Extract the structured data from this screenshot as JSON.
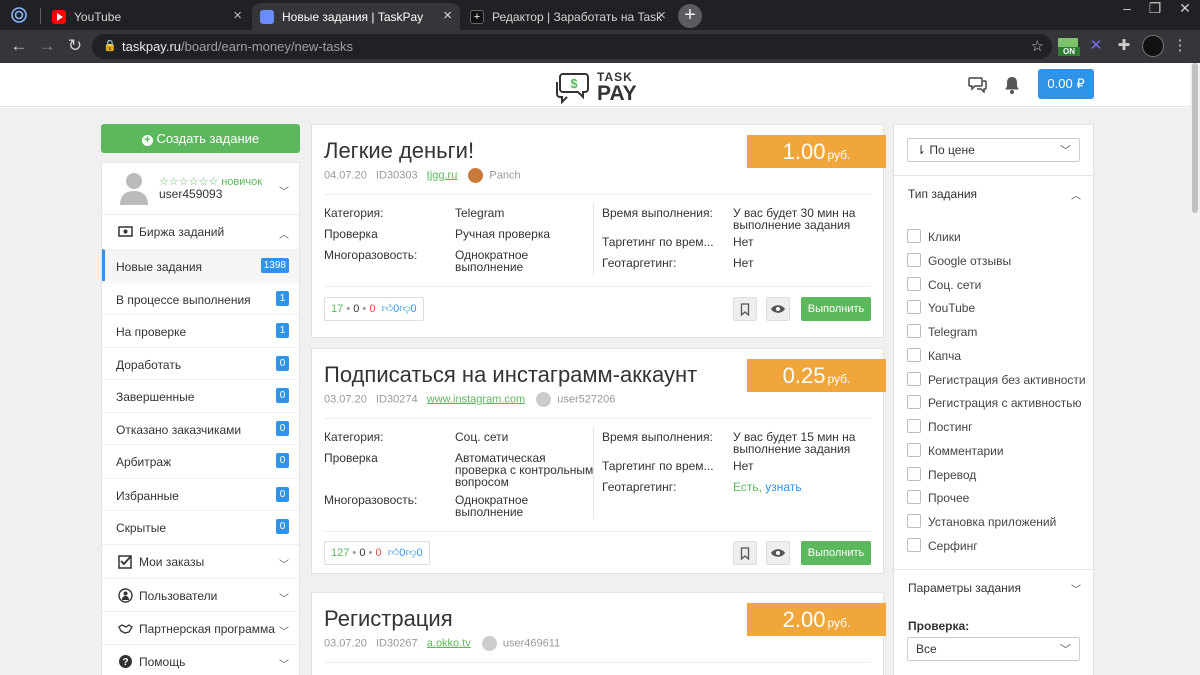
{
  "browser": {
    "tabs": [
      {
        "title": "YouTube"
      },
      {
        "title": "Новые задания | TaskPay"
      },
      {
        "title": "Редактор | Заработать на TaskPay"
      }
    ],
    "url_host": "taskpay.ru",
    "url_path": "/board/earn-money/new-tasks",
    "ext_badge": "ON"
  },
  "header": {
    "logo_top": "TASK",
    "logo_bottom": "PAY",
    "balance": "0.00 ₽"
  },
  "sidebar": {
    "create_button": "Создать задание",
    "user": {
      "rank": "☆☆☆☆☆☆ новичок",
      "name": "user459093"
    },
    "exchange_section": "Биржа заданий",
    "items": [
      {
        "label": "Новые задания",
        "count": "1398"
      },
      {
        "label": "В процессе выполнения",
        "count": "1"
      },
      {
        "label": "На проверке",
        "count": "1"
      },
      {
        "label": "Доработать",
        "count": "0"
      },
      {
        "label": "Завершенные",
        "count": "0"
      },
      {
        "label": "Отказано заказчиками",
        "count": "0"
      },
      {
        "label": "Арбитраж",
        "count": "0"
      },
      {
        "label": "Избранные",
        "count": "0"
      },
      {
        "label": "Скрытые",
        "count": "0"
      }
    ],
    "sections": [
      {
        "label": "Мои заказы"
      },
      {
        "label": "Пользователи"
      },
      {
        "label": "Партнерская программа"
      },
      {
        "label": "Помощь"
      }
    ]
  },
  "labels": {
    "category": "Категория:",
    "check": "Проверка",
    "reuse": "Многоразовость:",
    "exec_time": "Время выполнения:",
    "time_targeting": "Таргетинг по врем...",
    "geo_targeting": "Геотаргетинг:",
    "currency": "руб.",
    "execute_button": "Выполнить"
  },
  "tasks": [
    {
      "title": "Легкие деньги!",
      "price": "1.00",
      "date": "04.07.20",
      "id": "ID30303",
      "site": "tjgg.ru",
      "author": "Panch",
      "category": "Telegram",
      "check": "Ручная проверка",
      "reuse_l1": "Однократное",
      "reuse_l2": "выполнение",
      "exec_l1": "У вас будет 30 мин на",
      "exec_l2": "выполнение задания",
      "time_targeting": "Нет",
      "geo_targeting": "Нет",
      "stat_done": "17",
      "stat_mid": "0",
      "stat_fail": "0",
      "likes": "0",
      "dislikes": "0"
    },
    {
      "title": "Подписаться на инстаграмм-аккаунт",
      "price": "0.25",
      "date": "03.07.20",
      "id": "ID30274",
      "site": "www.instagram.com",
      "author": "user527206",
      "category": "Соц. сети",
      "check_l1": "Автоматическая",
      "check_l2": "проверка с контрольным",
      "check_l3": "вопросом",
      "reuse_l1": "Однократное",
      "reuse_l2": "выполнение",
      "exec_l1": "У вас будет 15 мин на",
      "exec_l2": "выполнение задания",
      "time_targeting": "Нет",
      "geo_targeting": "Есть,",
      "geo_link": "узнать",
      "stat_done": "127",
      "stat_mid": "0",
      "stat_fail": "0",
      "likes": "0",
      "dislikes": "0"
    },
    {
      "title": "Регистрация",
      "price": "2.00",
      "date": "03.07.20",
      "id": "ID30267",
      "site": "a.okko.tv",
      "author": "user469611"
    }
  ],
  "filter": {
    "sort_value": "По цене",
    "type_header": "Тип задания",
    "types": [
      "Клики",
      "Google отзывы",
      "Соц. сети",
      "YouTube",
      "Telegram",
      "Капча",
      "Регистрация без активности",
      "Регистрация с активностью",
      "Постинг",
      "Комментарии",
      "Перевод",
      "Прочее",
      "Установка приложений",
      "Серфинг"
    ],
    "params_header": "Параметры задания",
    "check_label": "Проверка:",
    "check_value": "Все"
  },
  "colors": {
    "green": "#5cb85c",
    "blue": "#2f94e8",
    "orange": "#f0a63b",
    "chrome_dark": "#202124"
  }
}
